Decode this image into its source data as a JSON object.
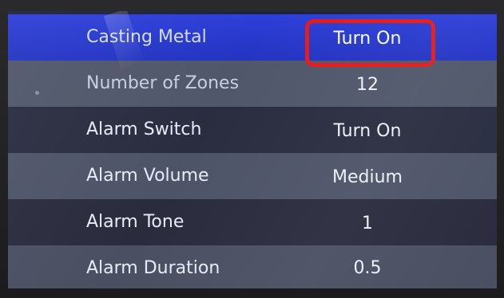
{
  "settings": {
    "rows": [
      {
        "label": "Casting Metal",
        "value": "Turn On"
      },
      {
        "label": "Number of Zones",
        "value": "12"
      },
      {
        "label": "Alarm Switch",
        "value": "Turn On"
      },
      {
        "label": "Alarm Volume",
        "value": "Medium"
      },
      {
        "label": "Alarm Tone",
        "value": "1"
      },
      {
        "label": "Alarm Duration",
        "value": "0.5"
      }
    ],
    "selected_index": 0
  },
  "colors": {
    "selected_row": "#2a3ad0",
    "row_light": "#4e5468",
    "row_dark": "#2a2d40",
    "highlight_border": "#e31b1b",
    "text": "#e9ecf6"
  }
}
